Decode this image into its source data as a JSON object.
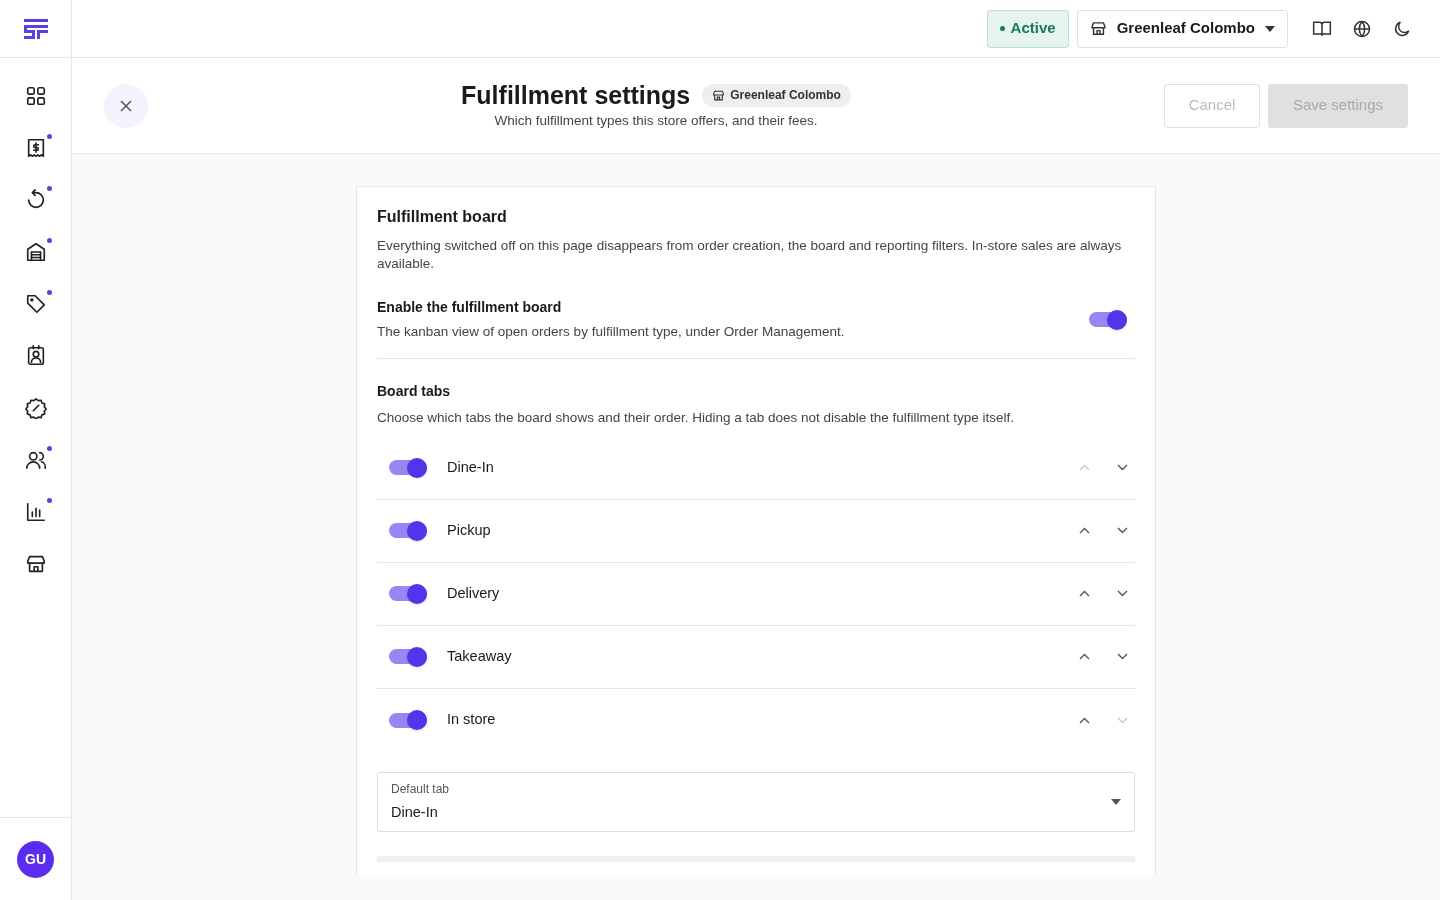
{
  "sidebar": {
    "items": [
      {
        "kind": "grid",
        "badge": false
      },
      {
        "kind": "receipt",
        "badge": true
      },
      {
        "kind": "refresh",
        "badge": true
      },
      {
        "kind": "garage",
        "badge": true
      },
      {
        "kind": "tag",
        "badge": true
      },
      {
        "kind": "contact",
        "badge": false
      },
      {
        "kind": "discount",
        "badge": false
      },
      {
        "kind": "users",
        "badge": true
      },
      {
        "kind": "chart",
        "badge": true
      },
      {
        "kind": "store",
        "badge": false
      }
    ],
    "avatar": "GU"
  },
  "topbar": {
    "status": {
      "label": "Active",
      "active": true
    },
    "store_select": "Greenleaf Colombo"
  },
  "header": {
    "title": "Fulfillment settings",
    "store_chip": "Greenleaf Colombo",
    "subtitle": "Which fulfillment types this store offers, and their fees.",
    "cancel": {
      "label": "Cancel",
      "disabled": true
    },
    "save": {
      "label": "Save settings",
      "disabled": true
    }
  },
  "card": {
    "title": "Fulfillment board",
    "description": "Everything switched off on this page disappears from order creation, the board and reporting filters. In-store sales are always available.",
    "board_toggle": {
      "label": "Enable the fulfillment board",
      "description": "The kanban view of open orders by fulfillment type, under Order Management.",
      "on": true
    },
    "tabs_section": {
      "title": "Board tabs",
      "description": "Choose which tabs the board shows and their order. Hiding a tab does not disable the fulfillment type itself.",
      "tabs": [
        {
          "label": "Dine-In",
          "on": true,
          "up_disabled": true,
          "down_disabled": false
        },
        {
          "label": "Pickup",
          "on": true,
          "up_disabled": false,
          "down_disabled": false
        },
        {
          "label": "Delivery",
          "on": true,
          "up_disabled": false,
          "down_disabled": false
        },
        {
          "label": "Takeaway",
          "on": true,
          "up_disabled": false,
          "down_disabled": false
        },
        {
          "label": "In store",
          "on": true,
          "up_disabled": false,
          "down_disabled": true
        }
      ]
    },
    "default_tab": {
      "label": "Default tab",
      "value": "Dine-In"
    }
  }
}
